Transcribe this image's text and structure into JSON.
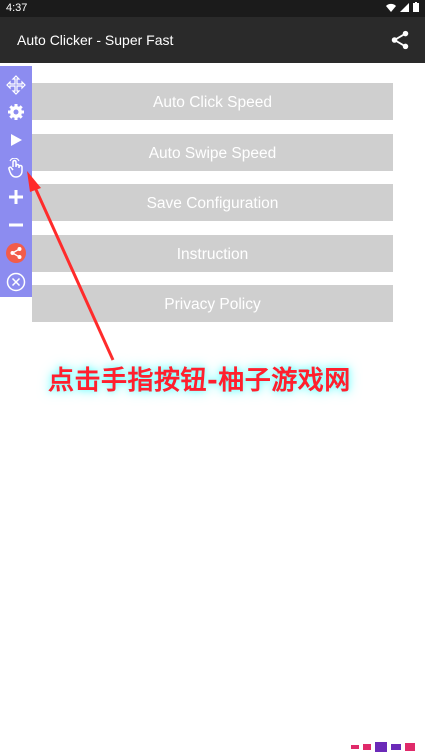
{
  "status": {
    "time": "4:37"
  },
  "app": {
    "title": "Auto Clicker - Super Fast",
    "share_icon": "share-icon"
  },
  "menu": {
    "items": [
      {
        "label": "Auto Click Speed"
      },
      {
        "label": "Auto Swipe Speed"
      },
      {
        "label": "Save Configuration"
      },
      {
        "label": "Instruction"
      },
      {
        "label": "Privacy Policy"
      }
    ]
  },
  "toolbar": {
    "icons": [
      "move-icon",
      "gear-icon",
      "play-icon",
      "tap-hand-icon",
      "plus-icon",
      "minus-icon",
      "share-icon",
      "close-icon"
    ]
  },
  "annotation": {
    "text": "点击手指按钮-柚子游戏网"
  },
  "colors": {
    "toolbar": "#8c8cf0",
    "button": "#cfcfcf",
    "annotation": "#ff1f2d",
    "share_badge": "#f25c4a"
  }
}
